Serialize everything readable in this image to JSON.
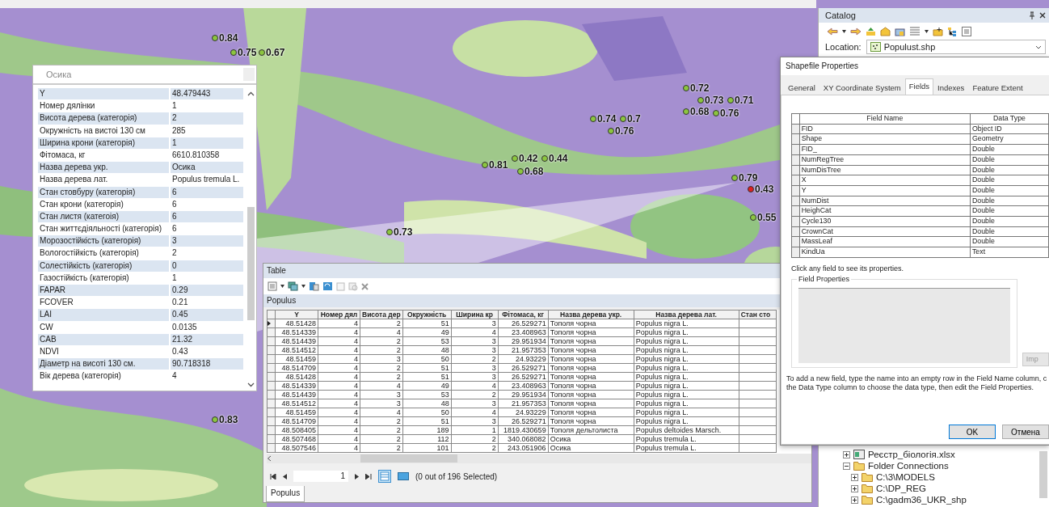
{
  "map": {
    "points": [
      {
        "label": "0.84",
        "color": "#8cc63f"
      },
      {
        "label": "0.75",
        "color": "#8cc63f"
      },
      {
        "label": "0.67",
        "color": "#8cc63f"
      },
      {
        "label": "0.72",
        "color": "#8cc63f"
      },
      {
        "label": "0.73",
        "color": "#8cc63f"
      },
      {
        "label": "0.68",
        "color": "#8cc63f"
      },
      {
        "label": "0.71",
        "color": "#8cc63f"
      },
      {
        "label": "0.76",
        "color": "#8cc63f"
      },
      {
        "label": "0.74",
        "color": "#8cc63f"
      },
      {
        "label": "0.7",
        "color": "#8cc63f"
      },
      {
        "label": "0.76",
        "color": "#8cc63f"
      },
      {
        "label": "0.81",
        "color": "#8cc63f"
      },
      {
        "label": "0.42",
        "color": "#8cc63f"
      },
      {
        "label": "0.44",
        "color": "#8cc63f"
      },
      {
        "label": "0.68",
        "color": "#8cc63f"
      },
      {
        "label": "0.79",
        "color": "#8cc63f"
      },
      {
        "label": "0.43",
        "color": "#e02020"
      },
      {
        "label": "0.55",
        "color": "#8cc63f"
      },
      {
        "label": "0.73",
        "color": "#8cc63f"
      },
      {
        "label": "0.83",
        "color": "#8cc63f"
      }
    ]
  },
  "popup": {
    "title": "Осика",
    "rows": [
      [
        "Y",
        "48.479443"
      ],
      [
        "Номер дялінки",
        "1"
      ],
      [
        "Висота дерева (категорія)",
        "2"
      ],
      [
        "Окружність на вистоі 130 см",
        "285"
      ],
      [
        "Ширина крони (категорія)",
        "1"
      ],
      [
        "Фітомаса, кг",
        "6610.810358"
      ],
      [
        "Назва дерева укр.",
        "Осика"
      ],
      [
        "Назва дерева лат.",
        "Populus tremula L."
      ],
      [
        "Стан стовбуру (категорія)",
        "6"
      ],
      [
        "Стан крони (категорія)",
        "6"
      ],
      [
        "Стан листя (категоія)",
        "6"
      ],
      [
        "Стан життєдіяльності (категорія)",
        "6"
      ],
      [
        "Морозостійкість (категорія)",
        "3"
      ],
      [
        "Вологостійкість (категорія)",
        "2"
      ],
      [
        "Солестійкість (категорія)",
        "0"
      ],
      [
        "Газостійкість (категорія)",
        "1"
      ],
      [
        "FAPAR",
        "0.29"
      ],
      [
        "FCOVER",
        "0.21"
      ],
      [
        "LAI",
        "0.45"
      ],
      [
        "CW",
        "0.0135"
      ],
      [
        "CAB",
        "21.32"
      ],
      [
        "NDVI",
        "0.43"
      ],
      [
        "Діаметр на висоті 130 см.",
        "90.718318"
      ],
      [
        "Вік дерева (категорія)",
        "4"
      ]
    ]
  },
  "table": {
    "title": "Table",
    "layer": "Populus",
    "columns": [
      "Y",
      "Номер дял",
      "Висота дер",
      "Окружність",
      "Ширина кр",
      "Фітомаса, кг",
      "Назва дерева укр.",
      "Назва дерева лат.",
      "Стан сто"
    ],
    "rows": [
      {
        "current": true,
        "cells": [
          "48.51428",
          "4",
          "2",
          "51",
          "3",
          "26.529271",
          "Тополя чорна",
          "Populus nigra L."
        ]
      },
      {
        "current": false,
        "cells": [
          "48.514339",
          "4",
          "4",
          "49",
          "4",
          "23.408963",
          "Тополя чорна",
          "Populus nigra L."
        ]
      },
      {
        "current": false,
        "cells": [
          "48.514439",
          "4",
          "2",
          "53",
          "3",
          "29.951934",
          "Тополя чорна",
          "Populus nigra L."
        ]
      },
      {
        "current": false,
        "cells": [
          "48.514512",
          "4",
          "2",
          "48",
          "3",
          "21.957353",
          "Тополя чорна",
          "Populus nigra L."
        ]
      },
      {
        "current": false,
        "cells": [
          "48.51459",
          "4",
          "3",
          "50",
          "2",
          "24.93229",
          "Тополя чорна",
          "Populus nigra L."
        ]
      },
      {
        "current": false,
        "cells": [
          "48.514709",
          "4",
          "2",
          "51",
          "3",
          "26.529271",
          "Тополя чорна",
          "Populus nigra L."
        ]
      },
      {
        "current": false,
        "cells": [
          "48.51428",
          "4",
          "2",
          "51",
          "3",
          "26.529271",
          "Тополя чорна",
          "Populus nigra L."
        ]
      },
      {
        "current": false,
        "cells": [
          "48.514339",
          "4",
          "4",
          "49",
          "4",
          "23.408963",
          "Тополя чорна",
          "Populus nigra L."
        ]
      },
      {
        "current": false,
        "cells": [
          "48.514439",
          "4",
          "3",
          "53",
          "2",
          "29.951934",
          "Тополя чорна",
          "Populus nigra L."
        ]
      },
      {
        "current": false,
        "cells": [
          "48.514512",
          "4",
          "3",
          "48",
          "3",
          "21.957353",
          "Тополя чорна",
          "Populus nigra L."
        ]
      },
      {
        "current": false,
        "cells": [
          "48.51459",
          "4",
          "4",
          "50",
          "4",
          "24.93229",
          "Тополя чорна",
          "Populus nigra L."
        ]
      },
      {
        "current": false,
        "cells": [
          "48.514709",
          "4",
          "2",
          "51",
          "3",
          "26.529271",
          "Тополя чорна",
          "Populus nigra L."
        ]
      },
      {
        "current": false,
        "cells": [
          "48.508405",
          "4",
          "2",
          "189",
          "1",
          "1819.430659",
          "Тополя дельтолиста",
          "Populus deltoides Marsch."
        ]
      },
      {
        "current": false,
        "cells": [
          "48.507468",
          "4",
          "2",
          "112",
          "2",
          "340.068082",
          "Осика",
          "Populus tremula L."
        ]
      },
      {
        "current": false,
        "cells": [
          "48.507546",
          "4",
          "2",
          "101",
          "2",
          "243.051906",
          "Осика",
          "Populus tremula L."
        ]
      }
    ],
    "record": "1",
    "selection": "(0 out of 196 Selected)",
    "tab": "Populus"
  },
  "catalog": {
    "title": "Catalog",
    "location_label": "Location:",
    "location": "Populust.shp",
    "tree": [
      {
        "label": "Реєстр_біологія.xlsx",
        "kind": "spreadsheet",
        "expanded": false
      },
      {
        "label": "Folder Connections",
        "kind": "folder",
        "expanded": true,
        "children": [
          {
            "label": "C:\\3\\MODELS",
            "kind": "folder",
            "expanded": false
          },
          {
            "label": "C:\\DP_REG",
            "kind": "folder",
            "expanded": false
          },
          {
            "label": "C:\\gadm36_UKR_shp",
            "kind": "folder",
            "expanded": false
          }
        ]
      }
    ]
  },
  "dialog": {
    "title": "Shapefile Properties",
    "tabs": [
      {
        "label": "General",
        "selected": false
      },
      {
        "label": "XY Coordinate System",
        "selected": false
      },
      {
        "label": "Fields",
        "selected": true
      },
      {
        "label": "Indexes",
        "selected": false
      },
      {
        "label": "Feature Extent",
        "selected": false
      }
    ],
    "columns": [
      "Field Name",
      "Data Type"
    ],
    "fields": [
      [
        "FID",
        "Object ID"
      ],
      [
        "Shape",
        "Geometry"
      ],
      [
        "FID_",
        "Double"
      ],
      [
        "NumRegTree",
        "Double"
      ],
      [
        "NumDisTree",
        "Double"
      ],
      [
        "X",
        "Double"
      ],
      [
        "Y",
        "Double"
      ],
      [
        "NumDist",
        "Double"
      ],
      [
        "HeighCat",
        "Double"
      ],
      [
        "Cycle130",
        "Double"
      ],
      [
        "CrownCat",
        "Double"
      ],
      [
        "MassLeaf",
        "Double"
      ],
      [
        "KindUa",
        "Text"
      ]
    ],
    "hint": "Click any field to see its properties.",
    "group": "Field Properties",
    "import_button": {
      "label": "Imp",
      "disabled": true
    },
    "help": "To add a new field, type the name into an empty row in the Field Name column, c\nthe Data Type column to choose the data type, then edit the Field Properties.",
    "buttons": [
      {
        "label": "OK",
        "default": true
      },
      {
        "label": "Отмена",
        "default": false
      }
    ]
  }
}
